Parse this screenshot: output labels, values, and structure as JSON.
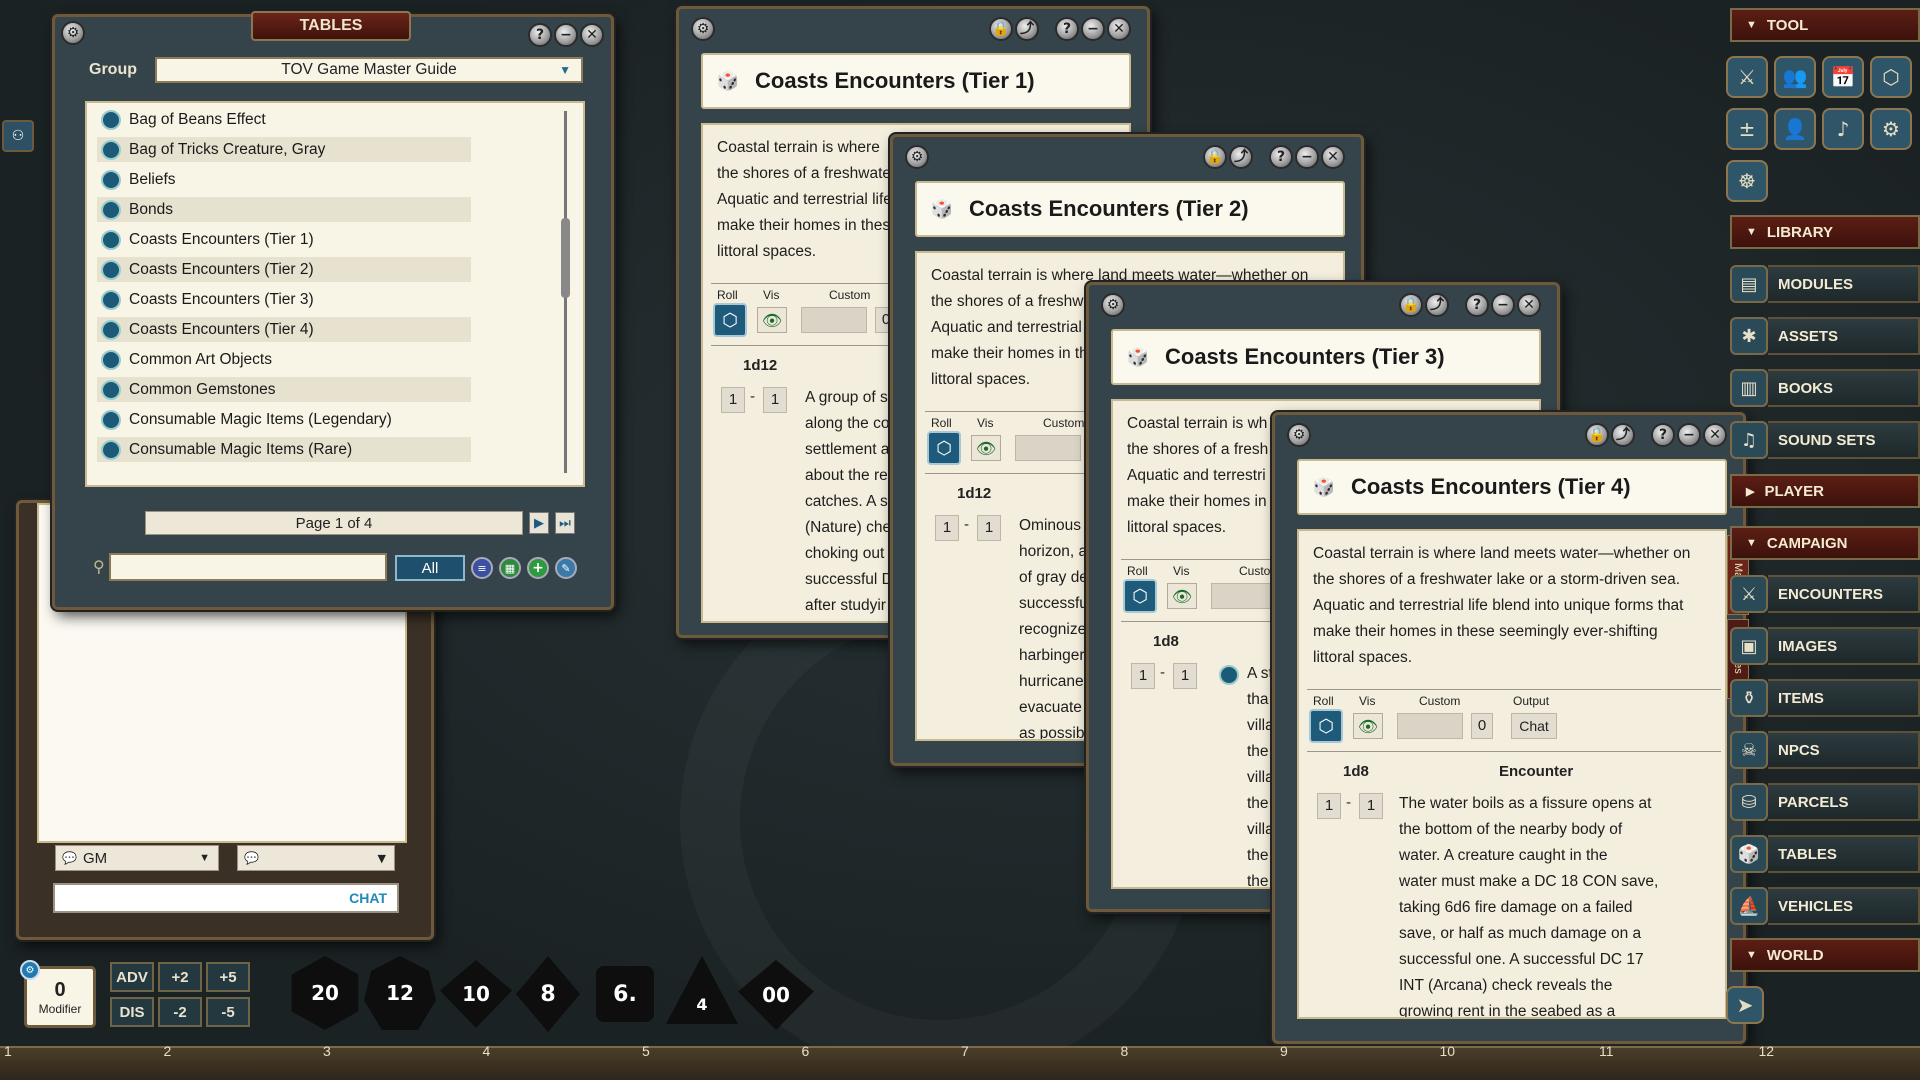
{
  "tables_window": {
    "title": "TABLES",
    "group_label": "Group",
    "group_value": "TOV Game Master Guide",
    "items": [
      "Bag of Beans Effect",
      "Bag of Tricks Creature, Gray",
      "Beliefs",
      "Bonds",
      "Coasts Encounters (Tier 1)",
      "Coasts Encounters (Tier 2)",
      "Coasts Encounters (Tier 3)",
      "Coasts Encounters (Tier 4)",
      "Common Art Objects",
      "Common Gemstones",
      "Consumable Magic Items (Legendary)",
      "Consumable Magic Items (Rare)"
    ],
    "page": "Page 1 of 4",
    "filter_all": "All"
  },
  "chat": {
    "gm_select": "GM",
    "chat_label": "CHAT"
  },
  "shared": {
    "roll": "Roll",
    "vis": "Vis",
    "custom": "Custom",
    "output": "Output",
    "chat_btn": "Chat",
    "zero": "0",
    "one": "1",
    "dash": "-",
    "encounter": "Encounter"
  },
  "tier1": {
    "title": "Coasts Encounters (Tier 1)",
    "desc": [
      "Coastal terrain is where",
      "the shores of a freshwate",
      "Aquatic and terrestrial life",
      "make their homes in these",
      "littoral spaces."
    ],
    "dice": "1d12",
    "entry": [
      "A group of s",
      "along the co",
      "settlement a",
      "about the re",
      "catches. A su",
      "(Nature) che",
      "choking out",
      "successful D",
      "after studyir"
    ]
  },
  "tier2": {
    "title": "Coasts Encounters (Tier 2)",
    "desc": [
      "Coastal terrain is where land meets water—whether on",
      "the shores of a freshw",
      "Aquatic and terrestrial",
      "make their homes in th",
      "littoral spaces."
    ],
    "dice": "1d12",
    "entry": [
      "Ominous",
      "horizon, a",
      "of gray de",
      "successfu",
      "recognize",
      "harbinger",
      "hurricane,",
      "evacuate",
      "as possibl"
    ]
  },
  "tier3": {
    "title": "Coasts Encounters (Tier 3)",
    "desc": [
      "Coastal terrain is wh",
      "the shores of a fresh",
      "Aquatic and terrestri",
      "make their homes in",
      "littoral spaces."
    ],
    "dice": "1d8",
    "entry": [
      "A st",
      "tha",
      "villa",
      "the",
      "villa",
      "the",
      "villa",
      "the",
      "the"
    ]
  },
  "tier4": {
    "title": "Coasts Encounters (Tier 4)",
    "desc": [
      "Coastal terrain is where land meets water—whether on",
      "the shores of a freshwater lake or a storm-driven sea.",
      "Aquatic and terrestrial life blend into unique forms that",
      "make their homes in these seemingly ever-shifting",
      "littoral spaces."
    ],
    "dice": "1d8",
    "entry": [
      "The water boils as a fissure opens at",
      "the bottom of the nearby body of",
      "water. A creature caught in the",
      "water must make a DC 18 CON save,",
      "taking 6d6 fire damage on a failed",
      "save, or half as much damage on a",
      "successful one. A successful DC 17",
      "INT (Arcana) check reveals the",
      "growing rent in the seabed as a"
    ],
    "tab_main": "Main",
    "tab_notes": "Notes"
  },
  "sidebar": {
    "tool": "TOOL",
    "library": "LIBRARY",
    "player": "PLAYER",
    "campaign": "CAMPAIGN",
    "world": "WORLD",
    "library_items": [
      "MODULES",
      "ASSETS",
      "BOOKS",
      "SOUND SETS"
    ],
    "campaign_items": [
      "ENCOUNTERS",
      "IMAGES",
      "ITEMS",
      "NPCS",
      "PARCELS",
      "TABLES",
      "VEHICLES"
    ]
  },
  "modifier": {
    "value": "0",
    "label": "Modifier",
    "adv": "ADV",
    "dis": "DIS",
    "p2": "+2",
    "p5": "+5",
    "m2": "-2",
    "m5": "-5"
  },
  "dice": [
    "20",
    "12",
    "10",
    "8",
    "6.",
    "4",
    "00"
  ],
  "ruler": [
    "1",
    "2",
    "3",
    "4",
    "5",
    "6",
    "7",
    "8",
    "9",
    "10",
    "11",
    "12"
  ]
}
